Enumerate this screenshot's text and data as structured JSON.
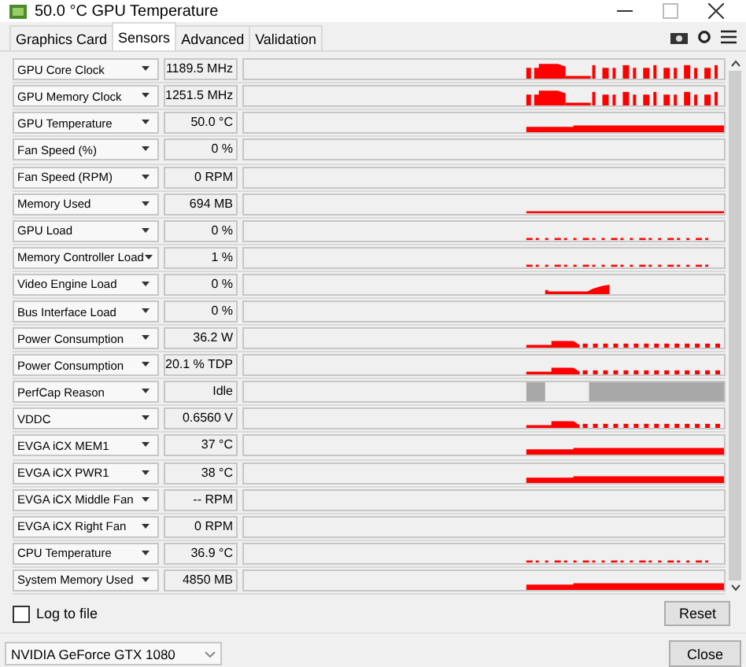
{
  "window": {
    "title": "50.0 °C GPU Temperature"
  },
  "tabs": [
    {
      "label": "Graphics Card",
      "selected": false
    },
    {
      "label": "Sensors",
      "selected": true
    },
    {
      "label": "Advanced",
      "selected": false
    },
    {
      "label": "Validation",
      "selected": false
    }
  ],
  "sensors": [
    {
      "name": "GPU Core Clock",
      "value": "1189.5 MHz",
      "kind": "clock"
    },
    {
      "name": "GPU Memory Clock",
      "value": "1251.5 MHz",
      "kind": "clock"
    },
    {
      "name": "GPU Temperature",
      "value": "50.0 °C",
      "kind": "band"
    },
    {
      "name": "Fan Speed (%)",
      "value": "0 %",
      "kind": "flat"
    },
    {
      "name": "Fan Speed (RPM)",
      "value": "0 RPM",
      "kind": "flat"
    },
    {
      "name": "Memory Used",
      "value": "694 MB",
      "kind": "line"
    },
    {
      "name": "GPU Load",
      "value": "0 %",
      "kind": "dots"
    },
    {
      "name": "Memory Controller Load",
      "value": "1 %",
      "kind": "dots"
    },
    {
      "name": "Video Engine Load",
      "value": "0 %",
      "kind": "hump"
    },
    {
      "name": "Bus Interface Load",
      "value": "0 %",
      "kind": "flat"
    },
    {
      "name": "Power Consumption",
      "value": "36.2 W",
      "kind": "power"
    },
    {
      "name": "Power Consumption",
      "value": "20.1 % TDP",
      "kind": "power"
    },
    {
      "name": "PerfCap Reason",
      "value": "Idle",
      "kind": "perfcap"
    },
    {
      "name": "VDDC",
      "value": "0.6560 V",
      "kind": "power"
    },
    {
      "name": "EVGA iCX MEM1",
      "value": "37 °C",
      "kind": "band"
    },
    {
      "name": "EVGA iCX PWR1",
      "value": "38 °C",
      "kind": "band"
    },
    {
      "name": "EVGA iCX Middle Fan",
      "value": "-- RPM",
      "kind": "flat"
    },
    {
      "name": "EVGA iCX Right Fan",
      "value": "0 RPM",
      "kind": "flat"
    },
    {
      "name": "CPU Temperature",
      "value": "36.9 °C",
      "kind": "dots"
    },
    {
      "name": "System Memory Used",
      "value": "4850 MB",
      "kind": "band"
    }
  ],
  "log_to_file": {
    "label": "Log to file",
    "checked": false
  },
  "reset_button": "Reset",
  "gpu_select": {
    "value": "NVIDIA GeForce GTX 1080"
  },
  "close_button": "Close"
}
